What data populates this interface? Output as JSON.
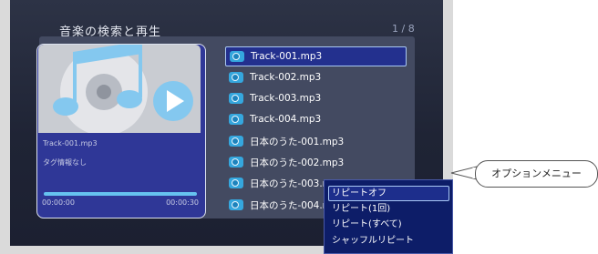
{
  "screen": {
    "title": "音楽の検索と再生",
    "page_count": "1 / 8"
  },
  "now_playing": {
    "file_name": "Track-001.mp3",
    "tag_info": "タグ情報なし",
    "progress": 1.0,
    "time_current": "00:00:00",
    "time_total": "00:00:30"
  },
  "tracks": [
    {
      "label": "Track-001.mp3",
      "selected": true
    },
    {
      "label": "Track-002.mp3"
    },
    {
      "label": "Track-003.mp3"
    },
    {
      "label": "Track-004.mp3"
    },
    {
      "label": "日本のうた-001.mp3"
    },
    {
      "label": "日本のうた-002.mp3"
    },
    {
      "label": "日本のうた-003.mp3"
    },
    {
      "label": "日本のうた-004.mp3"
    }
  ],
  "option_menu": {
    "items": [
      {
        "label": "リピートオフ",
        "selected": true
      },
      {
        "label": "リピート(1回)"
      },
      {
        "label": "リピート(すべて)"
      },
      {
        "label": "シャッフルリピート"
      }
    ]
  },
  "callout": {
    "label": "オプションメニュー"
  },
  "icons": {
    "track": "audio-file-icon",
    "music": "music-note-icon",
    "cd": "cd-disc-icon",
    "play": "play-icon"
  },
  "colors": {
    "accent_bar": "#66c2f0",
    "selection_border": "#a9c8f3",
    "menu_bg": "#0d1d68"
  }
}
